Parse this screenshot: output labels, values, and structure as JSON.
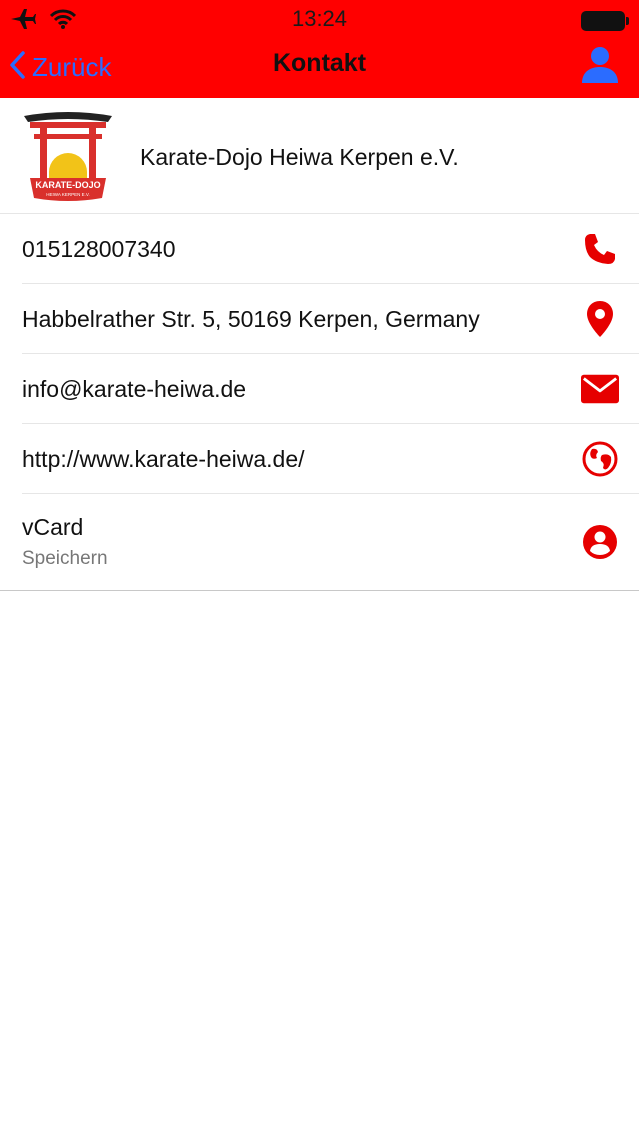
{
  "status_bar": {
    "time": "13:24"
  },
  "nav": {
    "back_label": "Zurück",
    "title": "Kontakt"
  },
  "colors": {
    "header_bg": "#ff0000",
    "accent": "#e60000",
    "link_blue": "#2b6cff"
  },
  "organization": {
    "name": "Karate-Dojo Heiwa Kerpen e.V.",
    "logo_text": "KARATE-DOJO",
    "logo_subtext": "HEIWA KERPEN E.V."
  },
  "contacts": [
    {
      "text": "015128007340",
      "icon": "phone-icon"
    },
    {
      "text": "Habbelrather Str. 5, 50169 Kerpen, Germany",
      "icon": "location-pin-icon"
    },
    {
      "text": "info@karate-heiwa.de",
      "icon": "mail-icon"
    },
    {
      "text": "http://www.karate-heiwa.de/",
      "icon": "globe-icon"
    },
    {
      "text": "vCard",
      "subtitle": "Speichern",
      "icon": "contact-card-icon"
    }
  ]
}
